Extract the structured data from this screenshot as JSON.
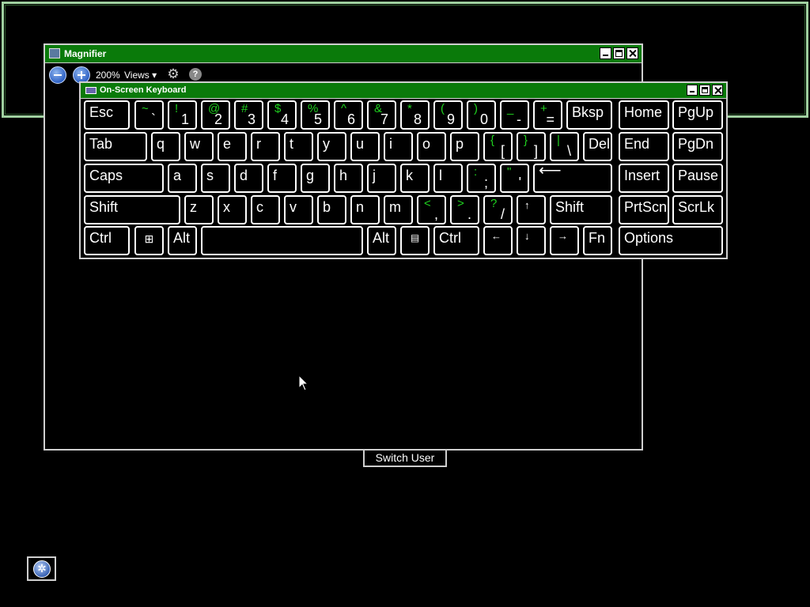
{
  "magnifier": {
    "title": "Magnifier",
    "zoom_level": "200%",
    "views_label": "Views ▾",
    "icons": {
      "zoom_out": "minus-circle-icon",
      "zoom_in": "plus-circle-icon",
      "settings": "gear-icon",
      "help": "help-icon"
    }
  },
  "osk": {
    "title": "On-Screen Keyboard",
    "row1": [
      {
        "label": "Esc"
      },
      {
        "shift": "~",
        "main": "`"
      },
      {
        "shift": "!",
        "main": "1"
      },
      {
        "shift": "@",
        "main": "2"
      },
      {
        "shift": "#",
        "main": "3"
      },
      {
        "shift": "$",
        "main": "4"
      },
      {
        "shift": "%",
        "main": "5"
      },
      {
        "shift": "^",
        "main": "6"
      },
      {
        "shift": "&",
        "main": "7"
      },
      {
        "shift": "*",
        "main": "8"
      },
      {
        "shift": "(",
        "main": "9"
      },
      {
        "shift": ")",
        "main": "0"
      },
      {
        "shift": "_",
        "main": "-"
      },
      {
        "shift": "+",
        "main": "="
      },
      {
        "label": "Bksp"
      },
      {
        "label": "Home"
      },
      {
        "label": "PgUp"
      }
    ],
    "row2": [
      {
        "label": "Tab"
      },
      {
        "label": "q"
      },
      {
        "label": "w"
      },
      {
        "label": "e"
      },
      {
        "label": "r"
      },
      {
        "label": "t"
      },
      {
        "label": "y"
      },
      {
        "label": "u"
      },
      {
        "label": "i"
      },
      {
        "label": "o"
      },
      {
        "label": "p"
      },
      {
        "shift": "{",
        "main": "["
      },
      {
        "shift": "}",
        "main": "]"
      },
      {
        "shift": "|",
        "main": "\\"
      },
      {
        "label": "Del"
      },
      {
        "label": "End"
      },
      {
        "label": "PgDn"
      }
    ],
    "row3": [
      {
        "label": "Caps"
      },
      {
        "label": "a"
      },
      {
        "label": "s"
      },
      {
        "label": "d"
      },
      {
        "label": "f"
      },
      {
        "label": "g"
      },
      {
        "label": "h"
      },
      {
        "label": "j"
      },
      {
        "label": "k"
      },
      {
        "label": "l"
      },
      {
        "shift": ":",
        "main": ";"
      },
      {
        "shift": "\"",
        "main": "'"
      },
      {
        "label": "⟵",
        "icon": "enter-icon"
      },
      {
        "label": "Insert"
      },
      {
        "label": "Pause"
      }
    ],
    "row4": [
      {
        "label": "Shift"
      },
      {
        "label": "z"
      },
      {
        "label": "x"
      },
      {
        "label": "c"
      },
      {
        "label": "v"
      },
      {
        "label": "b"
      },
      {
        "label": "n"
      },
      {
        "label": "m"
      },
      {
        "shift": "<",
        "main": ","
      },
      {
        "shift": ">",
        "main": "."
      },
      {
        "shift": "?",
        "main": "/"
      },
      {
        "label": "↑",
        "icon": "arrow-up-icon"
      },
      {
        "label": "Shift"
      },
      {
        "label": "PrtScn"
      },
      {
        "label": "ScrLk"
      }
    ],
    "row5": [
      {
        "label": "Ctrl"
      },
      {
        "label": "",
        "icon": "windows-logo-icon"
      },
      {
        "label": "Alt"
      },
      {
        "label": "",
        "icon": "spacebar"
      },
      {
        "label": "Alt"
      },
      {
        "label": "",
        "icon": "menu-icon"
      },
      {
        "label": "Ctrl"
      },
      {
        "label": "←",
        "icon": "arrow-left-icon"
      },
      {
        "label": "↓",
        "icon": "arrow-down-icon"
      },
      {
        "label": "→",
        "icon": "arrow-right-icon"
      },
      {
        "label": "Fn"
      },
      {
        "label": "Options"
      }
    ]
  },
  "switch_user_label": "Switch User",
  "ease_of_access_icon": "ease-of-access-icon",
  "colors": {
    "titlebar": "#0a7a0a",
    "shift_char": "#1fd31f",
    "background": "#000000",
    "border": "#ffffff"
  }
}
